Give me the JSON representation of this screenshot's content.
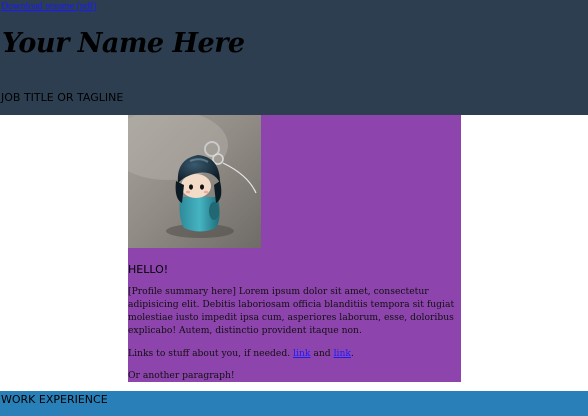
{
  "header": {
    "download_link": "Download resume (pdf)",
    "name": "Your Name Here",
    "tagline": "JOB TITLE OR TAGLINE",
    "background_color": "#2c3e50"
  },
  "profile": {
    "photo_icon": "keychain-doll-photo",
    "greeting": "HELLO!",
    "summary": "[Profile summary here] Lorem ipsum dolor sit amet, consectetur adipisicing elit. Debitis laboriosam officia blanditiis tempora sit fugiat molestiae iusto impedit ipsa cum, asperiores laborum, esse, doloribus explicabo! Autem, distinctio provident itaque non.",
    "links_prefix": "Links to stuff about you, if needed.",
    "link1": "link",
    "links_and": "and",
    "link2": "link",
    "links_suffix": ".",
    "another_paragraph": "Or another paragraph!",
    "background_color": "#8e44ad"
  },
  "work": {
    "title": "WORK EXPERIENCE",
    "background_color": "#2980b9"
  },
  "colors": {
    "link": "#1a1aff"
  }
}
